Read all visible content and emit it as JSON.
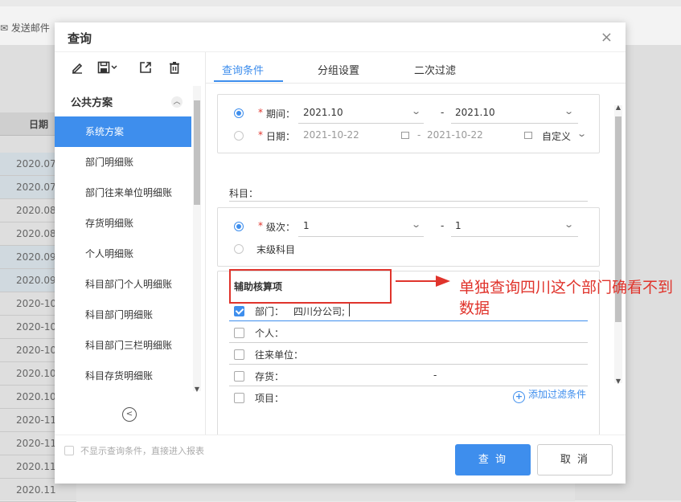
{
  "background": {
    "send_mail": "发送邮件",
    "date_header": "日期",
    "dates": [
      "2020.07",
      "2020.07",
      "2020.08",
      "2020.08",
      "2020.09",
      "2020.09",
      "2020-10",
      "2020-10",
      "2020-10",
      "2020.10",
      "2020.10",
      "2020-11",
      "2020-11",
      "2020.11",
      "2020.11"
    ]
  },
  "dialog": {
    "title": "查询",
    "close": "×"
  },
  "left_panel": {
    "group_title": "公共方案",
    "plans": [
      "系统方案",
      "部门明细账",
      "部门往来单位明细账",
      "存货明细账",
      "个人明细账",
      "科目部门个人明细账",
      "科目部门明细账",
      "科目部门三栏明细账",
      "科目存货明细账"
    ],
    "active_index": 0
  },
  "tabs": [
    "查询条件",
    "分组设置",
    "二次过滤"
  ],
  "period": {
    "label": "期间：",
    "from": "2021.10",
    "sep": "-",
    "to": "2021.10"
  },
  "date": {
    "label": "日期：",
    "from": "2021-10-22",
    "sep": "-",
    "to": "2021-10-22",
    "mode": "自定义"
  },
  "subject": {
    "label": "科目："
  },
  "level": {
    "label": "级次：",
    "from": "1",
    "sep": "-",
    "to": "1",
    "leaf_label": "末级科目"
  },
  "aux": {
    "title": "辅助核算项",
    "items": [
      {
        "label": "部门：",
        "value": "四川分公司;",
        "checked": true
      },
      {
        "label": "个人：",
        "value": "",
        "checked": false
      },
      {
        "label": "往来单位：",
        "value": "",
        "checked": false
      },
      {
        "label": "存货：",
        "value": "-",
        "checked": false
      },
      {
        "label": "项目：",
        "value": "",
        "checked": false
      }
    ]
  },
  "add_filter": "添加过滤条件",
  "footer": {
    "skip_label": "不显示查询条件，直接进入报表",
    "query": "查 询",
    "cancel": "取 消"
  },
  "annotation": {
    "text": "单独查询四川这个部门确看不到数据",
    "color": "#e0342c"
  },
  "colors": {
    "accent": "#3e8eed",
    "required": "#e0342c"
  }
}
